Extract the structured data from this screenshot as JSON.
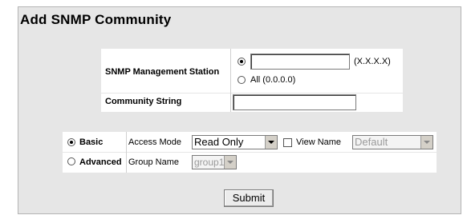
{
  "page": {
    "title": "Add SNMP Community"
  },
  "station": {
    "label": "SNMP Management Station",
    "ip_value": "",
    "format_hint": "(X.X.X.X)",
    "all_label": "All (0.0.0.0)",
    "selected": "ip"
  },
  "community": {
    "label": "Community String",
    "value": ""
  },
  "mode": {
    "selected": "basic",
    "basic_label": "Basic",
    "advanced_label": "Advanced",
    "access_mode_label": "Access Mode",
    "access_mode_value": "Read Only",
    "view_name_label": "View Name",
    "view_name_checked": false,
    "view_name_value": "Default",
    "group_name_label": "Group Name",
    "group_name_value": "group1"
  },
  "actions": {
    "submit_label": "Submit"
  }
}
